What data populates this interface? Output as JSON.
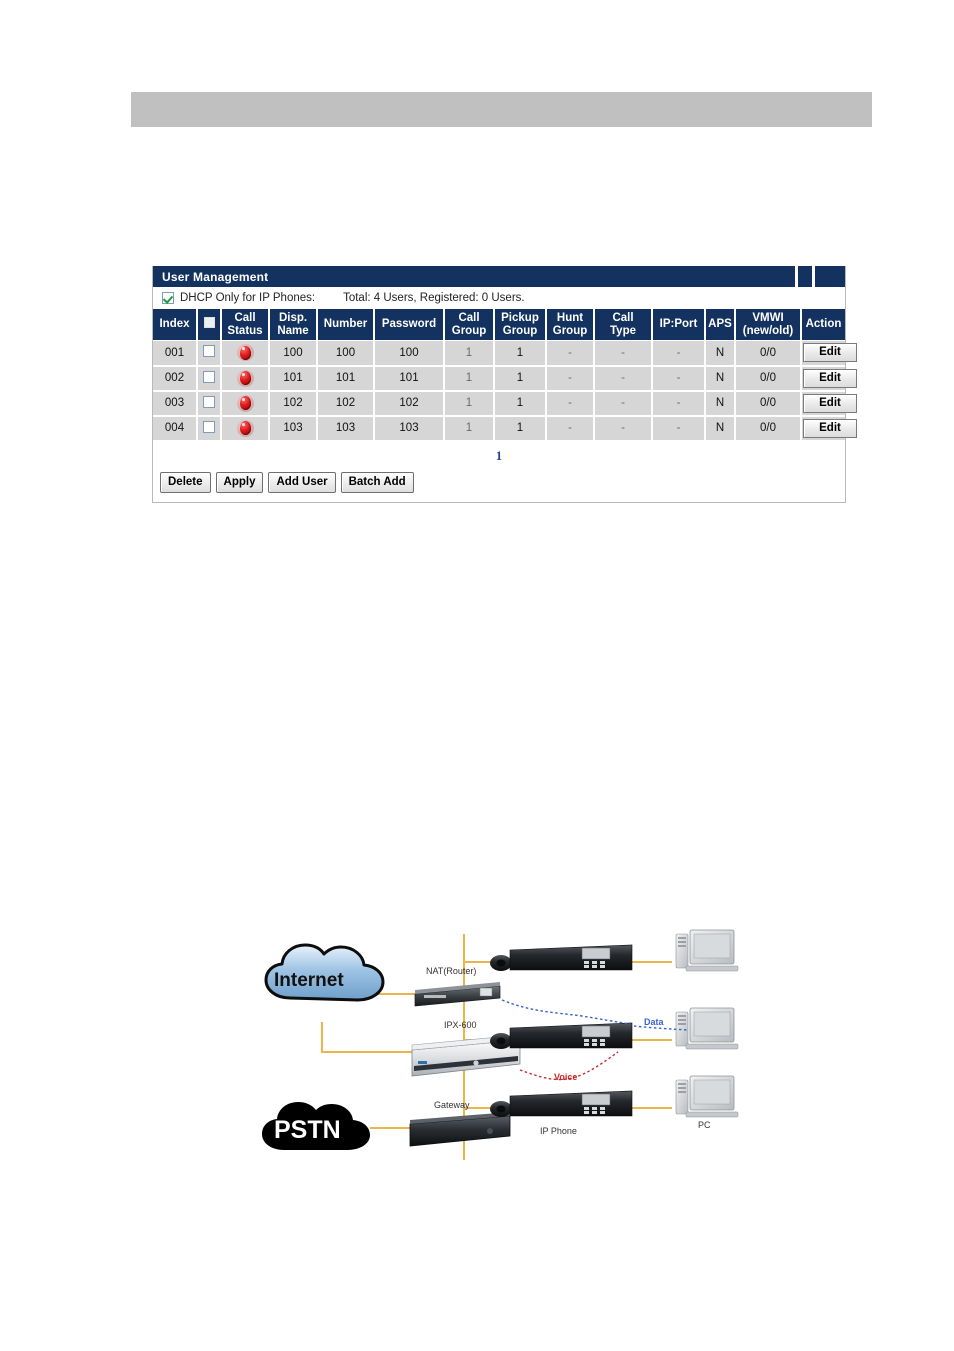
{
  "panel": {
    "title": "User Management",
    "window_buttons": [
      "minimize-box",
      "maximize-box",
      "close-box"
    ],
    "dhcp": {
      "checked": true,
      "label": "DHCP Only for IP Phones:",
      "totals": "Total: 4 Users, Registered: 0 Users."
    },
    "table": {
      "columns": [
        "Index",
        "",
        "Call Status",
        "Disp. Name",
        "Number",
        "Password",
        "Call Group",
        "Pickup Group",
        "Hunt Group",
        "Call Type",
        "IP:Port",
        "APS",
        "VMWI (new/old)",
        "Action"
      ],
      "columns_multiline": [
        [
          "Index"
        ],
        [
          ""
        ],
        [
          "Call",
          "Status"
        ],
        [
          "Disp.",
          "Name"
        ],
        [
          "Number"
        ],
        [
          "Password"
        ],
        [
          "Call",
          "Group"
        ],
        [
          "Pickup",
          "Group"
        ],
        [
          "Hunt",
          "Group"
        ],
        [
          "Call",
          "Type"
        ],
        [
          "IP:Port"
        ],
        [
          "APS"
        ],
        [
          "VMWI",
          "(new/old)"
        ],
        [
          "Action"
        ]
      ],
      "rows": [
        {
          "index": "001",
          "selected": false,
          "call_status": "offline-red-icon",
          "disp_name": "100",
          "number": "100",
          "password": "100",
          "call_group": "1",
          "pickup_group": "1",
          "hunt_group": "-",
          "call_type": "-",
          "ip_port": "-",
          "aps": "N",
          "vmwi": "0/0",
          "action": "Edit"
        },
        {
          "index": "002",
          "selected": false,
          "call_status": "offline-red-icon",
          "disp_name": "101",
          "number": "101",
          "password": "101",
          "call_group": "1",
          "pickup_group": "1",
          "hunt_group": "-",
          "call_type": "-",
          "ip_port": "-",
          "aps": "N",
          "vmwi": "0/0",
          "action": "Edit"
        },
        {
          "index": "003",
          "selected": false,
          "call_status": "offline-red-icon",
          "disp_name": "102",
          "number": "102",
          "password": "102",
          "call_group": "1",
          "pickup_group": "1",
          "hunt_group": "-",
          "call_type": "-",
          "ip_port": "-",
          "aps": "N",
          "vmwi": "0/0",
          "action": "Edit"
        },
        {
          "index": "004",
          "selected": false,
          "call_status": "offline-red-icon",
          "disp_name": "103",
          "number": "103",
          "password": "103",
          "call_group": "1",
          "pickup_group": "1",
          "hunt_group": "-",
          "call_type": "-",
          "ip_port": "-",
          "aps": "N",
          "vmwi": "0/0",
          "action": "Edit"
        }
      ]
    },
    "pager": {
      "current_page": "1"
    },
    "buttons": {
      "delete": "Delete",
      "apply": "Apply",
      "add_user": "Add User",
      "batch_add": "Batch Add"
    }
  },
  "diagram": {
    "clouds": {
      "internet": "Internet",
      "pstn": "PSTN"
    },
    "devices": {
      "nat_router": "NAT(Router)",
      "ipx": "IPX-600",
      "gateway": "Gateway",
      "ip_phone": "IP Phone",
      "pc": "PC"
    },
    "link_labels": {
      "data": "Data",
      "voice": "Voice"
    }
  },
  "colors": {
    "panel_header": "#14325f",
    "row_bg": "#d6d6d6",
    "banner": "#c0c0c0",
    "pager": "#27408b",
    "status_red": "#e01b1b",
    "data_blue": "#3b5fd0",
    "voice_red": "#c42b2b",
    "link_orange": "#e8b64c"
  }
}
